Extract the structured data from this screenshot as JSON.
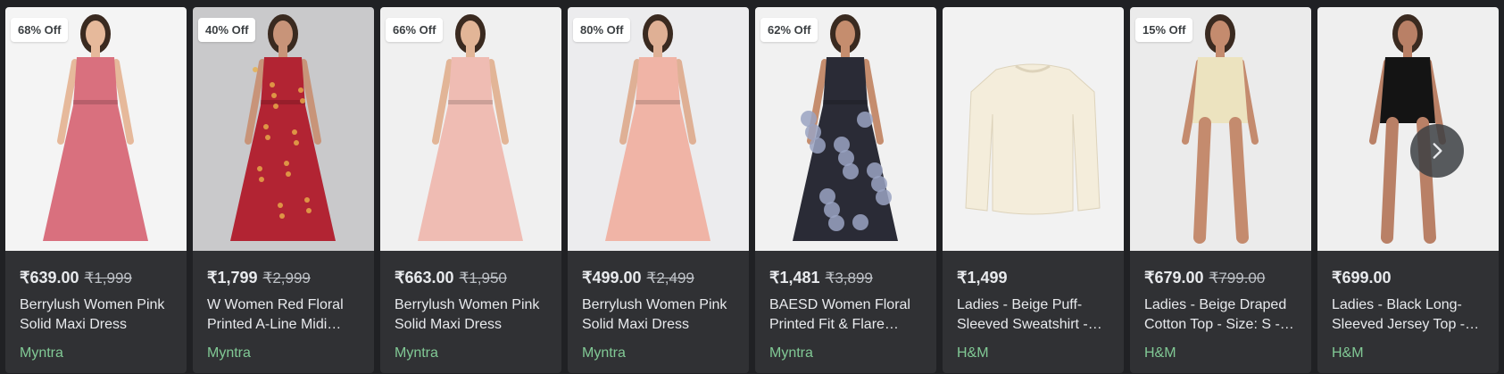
{
  "products": [
    {
      "discount": "68% Off",
      "price": "₹639.00",
      "old_price": "₹1,999",
      "title": "Berrylush Women Pink Solid Maxi Dress",
      "store": "Myntra",
      "bg": "#f4f4f4",
      "garment": "#d9707e",
      "skin": "#e6b99b"
    },
    {
      "discount": "40% Off",
      "price": "₹1,799",
      "old_price": "₹2,999",
      "title": "W Women Red Floral Printed A-Line Midi…",
      "store": "Myntra",
      "bg": "#c9c9cb",
      "garment": "#b22433",
      "skin": "#c89479"
    },
    {
      "discount": "66% Off",
      "price": "₹663.00",
      "old_price": "₹1,950",
      "title": "Berrylush Women Pink Solid Maxi Dress",
      "store": "Myntra",
      "bg": "#f0f0f0",
      "garment": "#efbcb3",
      "skin": "#e2b597"
    },
    {
      "discount": "80% Off",
      "price": "₹499.00",
      "old_price": "₹2,499",
      "title": "Berrylush Women Pink Solid Maxi Dress",
      "store": "Myntra",
      "bg": "#ececee",
      "garment": "#f0b4a6",
      "skin": "#dfb095"
    },
    {
      "discount": "62% Off",
      "price": "₹1,481",
      "old_price": "₹3,899",
      "title": "BAESD Women Floral Printed Fit & Flare…",
      "store": "Myntra",
      "bg": "#f1f1f1",
      "garment": "#2a2b36",
      "skin": "#c58d6e"
    },
    {
      "discount": "",
      "price": "₹1,499",
      "old_price": "",
      "title": "Ladies - Beige Puff-Sleeved Sweatshirt -…",
      "store": "H&M",
      "bg": "#f2f2f2",
      "garment": "#f4eddb",
      "skin": ""
    },
    {
      "discount": "15% Off",
      "price": "₹679.00",
      "old_price": "₹799.00",
      "title": "Ladies - Beige Draped Cotton Top - Size: S -…",
      "store": "H&M",
      "bg": "#ebebeb",
      "garment": "#ece3bf",
      "skin": "#c48b6e"
    },
    {
      "discount": "",
      "price": "₹699.00",
      "old_price": "",
      "title": "Ladies - Black Long-Sleeved Jersey Top -…",
      "store": "H&M",
      "bg": "#efefef",
      "garment": "#141414",
      "skin": "#b98066"
    }
  ],
  "icons": {
    "next": "chevron-right-icon"
  }
}
